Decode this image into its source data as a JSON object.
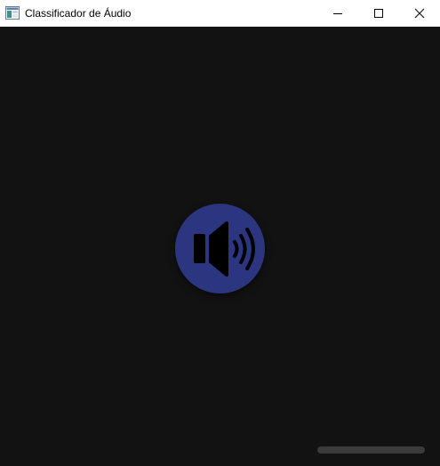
{
  "window": {
    "title": "Classificador de Áudio",
    "app_icon": "window-app-icon",
    "controls": {
      "minimize_icon": "minimize-icon",
      "maximize_icon": "maximize-icon",
      "close_icon": "close-icon"
    }
  },
  "main": {
    "speaker_button": {
      "icon": "speaker-volume-icon",
      "background_color": "#2b3580",
      "icon_color": "#000000"
    },
    "progress": {
      "value": 0.0
    },
    "background_color": "#121212"
  }
}
